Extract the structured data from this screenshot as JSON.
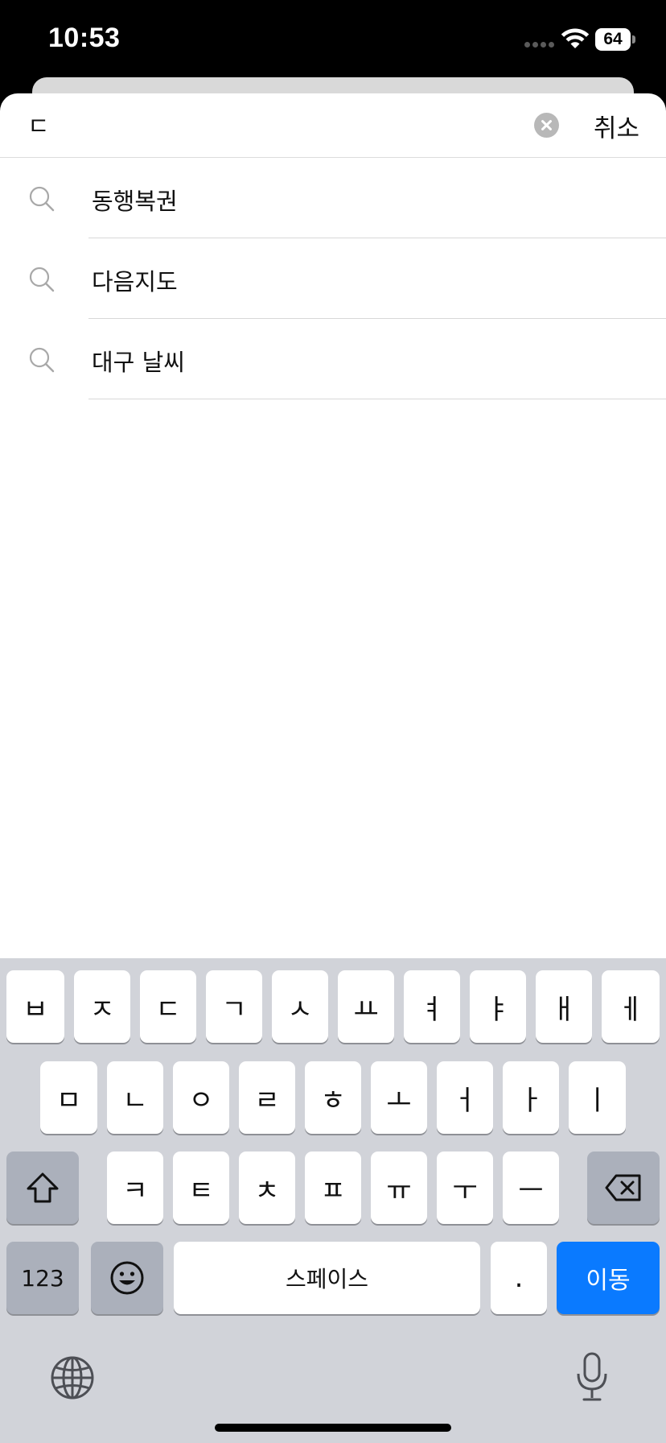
{
  "status_bar": {
    "time": "10:53",
    "battery": "64"
  },
  "search": {
    "query": "ㄷ",
    "cancel_label": "취소"
  },
  "suggestions": [
    {
      "label": "동행복권",
      "icon": "search-icon"
    },
    {
      "label": "다음지도",
      "icon": "search-icon"
    },
    {
      "label": "대구 날씨",
      "icon": "search-icon"
    }
  ],
  "keyboard": {
    "row1": [
      "ㅂ",
      "ㅈ",
      "ㄷ",
      "ㄱ",
      "ㅅ",
      "ㅛ",
      "ㅕ",
      "ㅑ",
      "ㅐ",
      "ㅔ"
    ],
    "row2": [
      "ㅁ",
      "ㄴ",
      "ㅇ",
      "ㄹ",
      "ㅎ",
      "ㅗ",
      "ㅓ",
      "ㅏ",
      "ㅣ"
    ],
    "row3": [
      "ㅋ",
      "ㅌ",
      "ㅊ",
      "ㅍ",
      "ㅠ",
      "ㅜ",
      "ㅡ"
    ],
    "numbers_label": "123",
    "space_label": "스페이스",
    "period_label": ".",
    "go_label": "이동",
    "icons": {
      "shift": "shift-icon",
      "delete": "backspace-icon",
      "emoji": "emoji-icon",
      "globe": "globe-icon",
      "mic": "microphone-icon"
    },
    "colors": {
      "go": "#0a7aff",
      "background": "#d1d3d9"
    }
  }
}
